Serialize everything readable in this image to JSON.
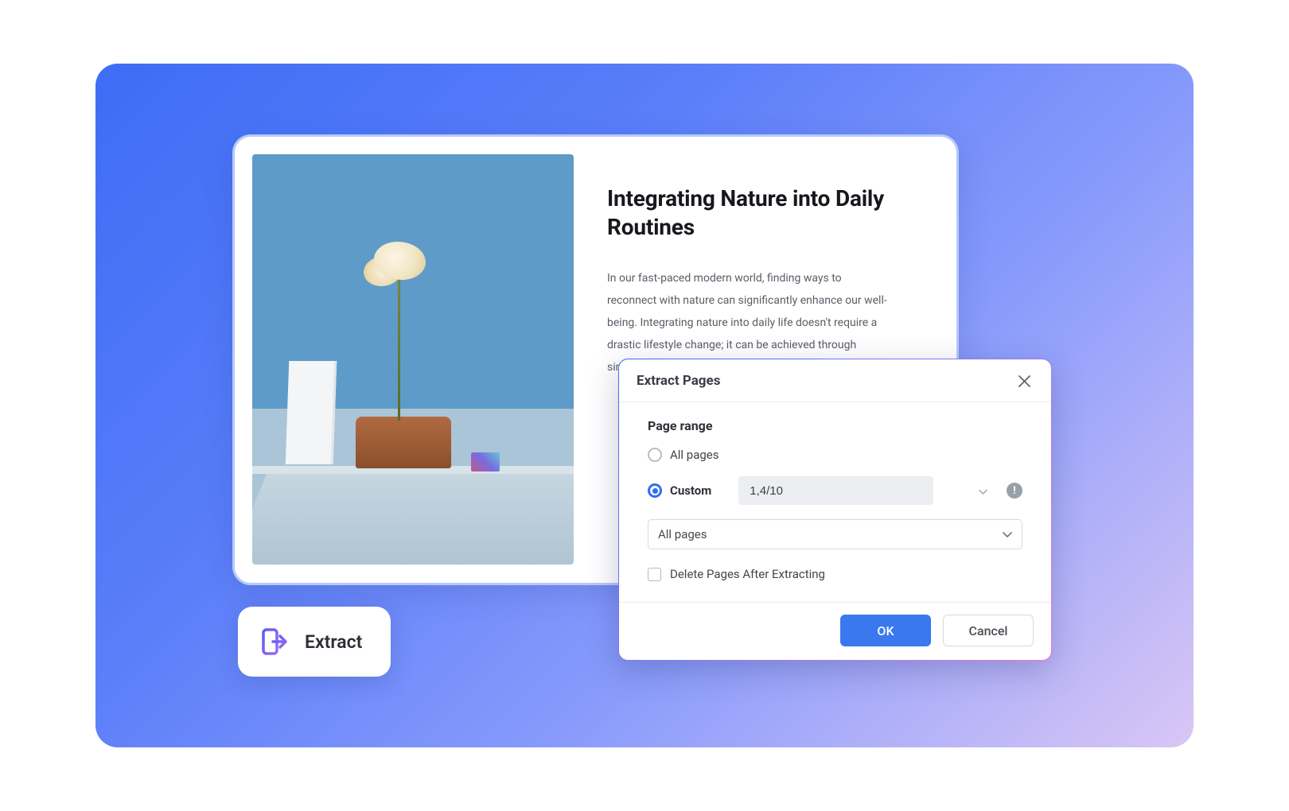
{
  "document": {
    "title": "Integrating Nature into Daily Routines",
    "body": "In our fast-paced modern world, finding ways to reconnect with nature can significantly enhance our well-being. Integrating nature into daily life doesn't require a drastic lifestyle change; it can be achieved through simple, mindful practices."
  },
  "extract_button": {
    "label": "Extract"
  },
  "dialog": {
    "title": "Extract Pages",
    "section_label": "Page range",
    "radio_all_label": "All pages",
    "radio_custom_label": "Custom",
    "custom_value": "1,4/10",
    "dropdown_value": "All pages",
    "checkbox_label": "Delete Pages After Extracting",
    "ok_label": "OK",
    "cancel_label": "Cancel",
    "info_glyph": "!",
    "selected_radio": "custom",
    "checkbox_checked": false
  },
  "colors": {
    "accent": "#3a78ef",
    "radio_selected": "#2f6df3"
  }
}
